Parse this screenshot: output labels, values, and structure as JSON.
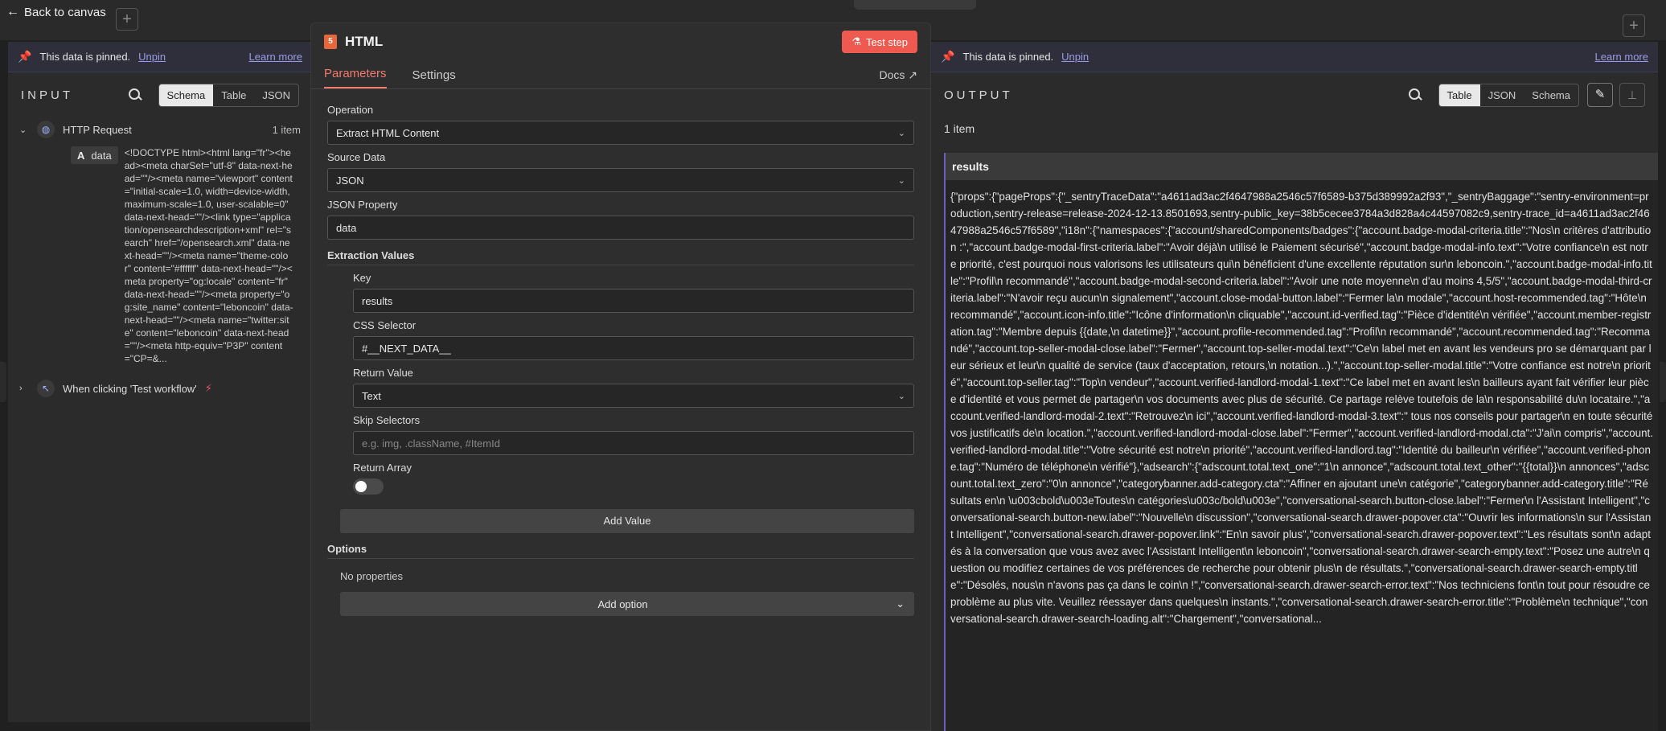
{
  "topbar": {
    "back_label": "Back to canvas"
  },
  "pinned": {
    "text": "This data is pinned.",
    "unpin": "Unpin",
    "learn_more": "Learn more"
  },
  "input": {
    "title": "INPUT",
    "views": [
      "Schema",
      "Table",
      "JSON"
    ],
    "active_view": "Schema",
    "node_name": "HTTP Request",
    "node_count": "1 item",
    "field_type": "A",
    "field_name": "data",
    "field_value": "<!DOCTYPE html><html lang=\"fr\"><head><meta charSet=\"utf-8\" data-next-head=\"\"/><meta name=\"viewport\" content=\"initial-scale=1.0, width=device-width, maximum-scale=1.0, user-scalable=0\" data-next-head=\"\"/><link type=\"application/opensearchdescription+xml\" rel=\"search\" href=\"/opensearch.xml\" data-next-head=\"\"/><meta name=\"theme-color\" content=\"#ffffff\" data-next-head=\"\"/><meta property=\"og:locale\" content=\"fr\" data-next-head=\"\"/><meta property=\"og:site_name\" content=\"leboncoin\" data-next-head=\"\"/><meta name=\"twitter:site\" content=\"leboncoin\" data-next-head=\"\"/><meta http-equiv=\"P3P\" content=\"CP=&...",
    "trigger_name": "When clicking 'Test workflow'"
  },
  "modal": {
    "title": "HTML",
    "icon_label": "5",
    "test_step": "Test step",
    "tabs": [
      "Parameters",
      "Settings"
    ],
    "active_tab": "Parameters",
    "docs": "Docs",
    "operation_label": "Operation",
    "operation_value": "Extract HTML Content",
    "source_label": "Source Data",
    "source_value": "JSON",
    "json_prop_label": "JSON Property",
    "json_prop_value": "data",
    "extraction_label": "Extraction Values",
    "key_label": "Key",
    "key_value": "results",
    "css_label": "CSS Selector",
    "css_value": "#__NEXT_DATA__",
    "return_label": "Return Value",
    "return_value": "Text",
    "skip_label": "Skip Selectors",
    "skip_placeholder": "e.g. img, .className, #ItemId",
    "array_label": "Return Array",
    "add_value": "Add Value",
    "options_label": "Options",
    "no_props": "No properties",
    "add_option": "Add option"
  },
  "output": {
    "title": "OUTPUT",
    "views": [
      "Table",
      "JSON",
      "Schema"
    ],
    "active_view": "Table",
    "count": "1 item",
    "column": "results",
    "value": "{\"props\":{\"pageProps\":{\"_sentryTraceData\":\"a4611ad3ac2f4647988a2546c57f6589-b375d389992a2f93\",\"_sentryBaggage\":\"sentry-environment=production,sentry-release=release-2024-12-13.8501693,sentry-public_key=38b5cecee3784a3d828a4c44597082c9,sentry-trace_id=a4611ad3ac2f4647988a2546c57f6589\",\"i18n\":{\"namespaces\":{\"account/sharedComponents/badges\":{\"account.badge-modal-criteria.title\":\"Nos\\n critères d'attribution :\",\"account.badge-modal-first-criteria.label\":\"Avoir déjà\\n utilisé le Paiement sécurisé\",\"account.badge-modal-info.text\":\"Votre confiance\\n est notre priorité, c'est pourquoi nous valorisons les utilisateurs qui\\n bénéficient d'une excellente réputation sur\\n leboncoin.\",\"account.badge-modal-info.title\":\"Profil\\n recommandé\",\"account.badge-modal-second-criteria.label\":\"Avoir une note moyenne\\n d'au moins 4,5/5\",\"account.badge-modal-third-criteria.label\":\"N'avoir reçu aucun\\n signalement\",\"account.close-modal-button.label\":\"Fermer la\\n modale\",\"account.host-recommended.tag\":\"Hôte\\n recommandé\",\"account.icon-info.title\":\"Icône d'information\\n cliquable\",\"account.id-verified.tag\":\"Pièce d'identité\\n vérifiée\",\"account.member-registration.tag\":\"Membre depuis {{date,\\n datetime}}\",\"account.profile-recommended.tag\":\"Profil\\n recommandé\",\"account.recommended.tag\":\"Recommandé\",\"account.top-seller-modal-close.label\":\"Fermer\",\"account.top-seller-modal.text\":\"Ce\\n label met en avant les vendeurs pro se démarquant par leur sérieux et leur\\n qualité de service (taux d'acceptation, retours,\\n notation...).\",\"account.top-seller-modal.title\":\"Votre confiance est notre\\n priorité\",\"account.top-seller.tag\":\"Top\\n vendeur\",\"account.verified-landlord-modal-1.text\":\"Ce label met en avant les\\n bailleurs ayant fait vérifier leur pièce d'identité et vous permet de partager\\n vos documents avec plus de sécurité. Ce partage relève toutefois de la\\n responsabilité du\\n locataire.\",\"account.verified-landlord-modal-2.text\":\"Retrouvez\\n ici\",\"account.verified-landlord-modal-3.text\":\" tous nos conseils pour partager\\n en toute sécurité vos justificatifs de\\n location.\",\"account.verified-landlord-modal-close.label\":\"Fermer\",\"account.verified-landlord-modal.cta\":\"J'ai\\n compris\",\"account.verified-landlord-modal.title\":\"Votre sécurité est notre\\n priorité\",\"account.verified-landlord.tag\":\"Identité du bailleur\\n vérifiée\",\"account.verified-phone.tag\":\"Numéro de téléphone\\n vérifié\"},\"adsearch\":{\"adscount.total.text_one\":\"1\\n annonce\",\"adscount.total.text_other\":\"{{total}}\\n annonces\",\"adscount.total.text_zero\":\"0\\n annonce\",\"categorybanner.add-category.cta\":\"Affiner en ajoutant une\\n catégorie\",\"categorybanner.add-category.title\":\"Résultats en\\n \\u003cbold\\u003eToutes\\n catégories\\u003c/bold\\u003e\",\"conversational-search.button-close.label\":\"Fermer\\n l'Assistant Intelligent\",\"conversational-search.button-new.label\":\"Nouvelle\\n discussion\",\"conversational-search.drawer-popover.cta\":\"Ouvrir les informations\\n sur l'Assistant Intelligent\",\"conversational-search.drawer-popover.link\":\"En\\n savoir plus\",\"conversational-search.drawer-popover.text\":\"Les résultats sont\\n adaptés à la conversation que vous avez avec l'Assistant Intelligent\\n leboncoin\",\"conversational-search.drawer-search-empty.text\":\"Posez une autre\\n question ou modifiez certaines de vos préférences de recherche pour obtenir plus\\n de résultats.\",\"conversational-search.drawer-search-empty.title\":\"Désolés, nous\\n n'avons pas ça dans le coin\\n !\",\"conversational-search.drawer-search-error.text\":\"Nos techniciens font\\n tout pour résoudre ce problème au plus vite. Veuillez réessayer dans quelques\\n instants.\",\"conversational-search.drawer-search-error.title\":\"Problème\\n technique\",\"conversational-search.drawer-search-loading.alt\":\"Chargement\",\"conversational..."
  }
}
